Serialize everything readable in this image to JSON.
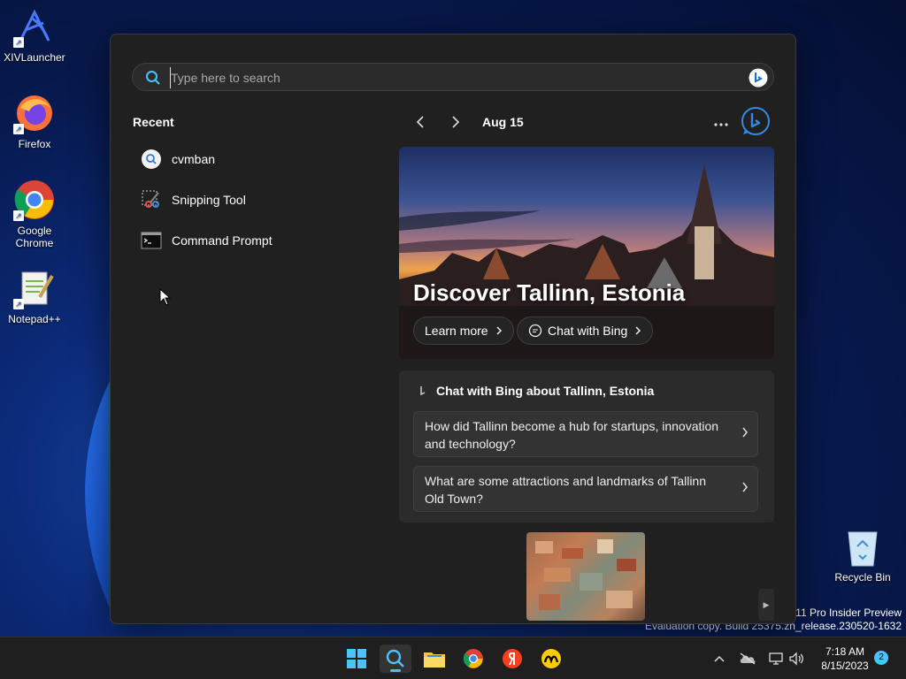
{
  "desktop": {
    "icons": [
      {
        "label": "XIVLauncher"
      },
      {
        "label": "Firefox"
      },
      {
        "label": "Google Chrome"
      },
      {
        "label": "Notepad++"
      },
      {
        "label": "Recycle Bin"
      }
    ],
    "watermark": {
      "line1": "s 11 Pro Insider Preview",
      "line2": "Evaluation copy. Build 25375.zn_release.230520-1632"
    }
  },
  "search": {
    "placeholder": "Type here to search",
    "value": ""
  },
  "recent": {
    "title": "Recent",
    "items": [
      {
        "label": "cvmban",
        "icon": "search-icon"
      },
      {
        "label": "Snipping Tool",
        "icon": "snipping-tool-icon"
      },
      {
        "label": "Command Prompt",
        "icon": "command-prompt-icon"
      }
    ]
  },
  "highlights": {
    "date": "Aug 15",
    "hero": {
      "title": "Discover Tallinn, Estonia",
      "learn_more": "Learn more",
      "chat_with_bing": "Chat with Bing"
    },
    "chat_card": {
      "title": "Chat with Bing about Tallinn, Estonia",
      "questions": [
        "How did Tallinn become a hub for startups, innovation and technology?",
        "What are some attractions and landmarks of Tallinn Old Town?"
      ]
    }
  },
  "taskbar": {
    "apps": [
      "start-icon",
      "search-icon",
      "file-explorer-icon",
      "chrome-icon",
      "yandex-icon",
      "toloka-icon"
    ],
    "clock": {
      "time": "7:18 AM",
      "date": "8/15/2023"
    },
    "notification_count": "2"
  },
  "colors": {
    "accent": "#4cc2ff",
    "panel_bg": "#202020",
    "card_bg": "#2b2b2b"
  }
}
